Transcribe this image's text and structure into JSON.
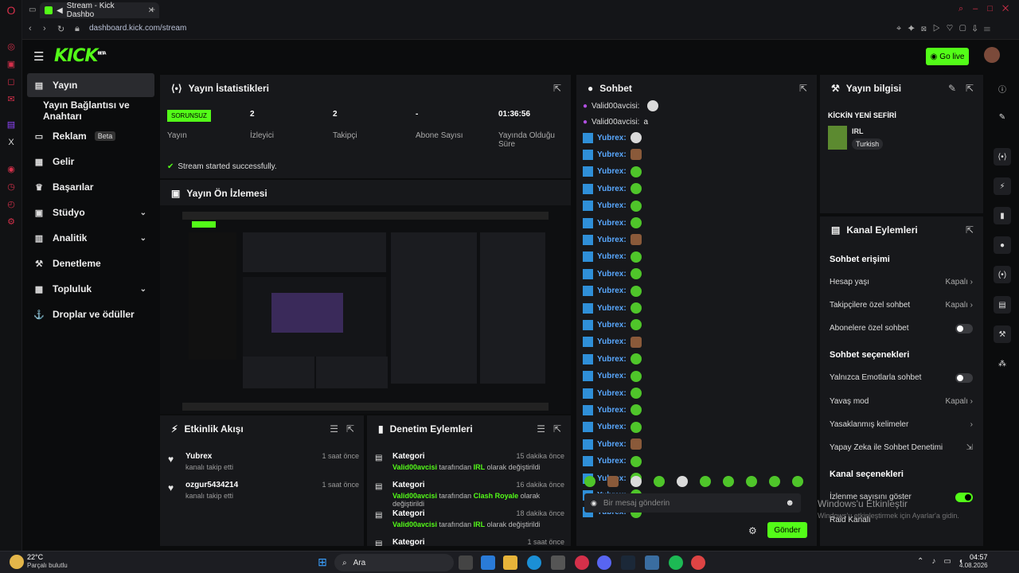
{
  "browser": {
    "tab_title": "Stream - Kick Dashbo",
    "url": "dashboard.kick.com/stream"
  },
  "header": {
    "logo": "KICK",
    "logo_badge": "BETA",
    "go_live": "Go live"
  },
  "sidebar": {
    "items": [
      {
        "label": "Yayın",
        "icon": "broadcast-icon"
      },
      {
        "label": "Yayın Bağlantısı ve Anahtarı",
        "icon": ""
      },
      {
        "label": "Reklam",
        "icon": "ad-icon",
        "badge": "Beta"
      },
      {
        "label": "Gelir",
        "icon": "revenue-icon"
      },
      {
        "label": "Başarılar",
        "icon": "trophy-icon"
      },
      {
        "label": "Stüdyo",
        "icon": "studio-icon"
      },
      {
        "label": "Analitik",
        "icon": "chart-icon"
      },
      {
        "label": "Denetleme",
        "icon": "wrench-icon"
      },
      {
        "label": "Topluluk",
        "icon": "community-icon"
      },
      {
        "label": "Droplar ve ödüller",
        "icon": "drops-icon"
      }
    ]
  },
  "stats": {
    "title": "Yayın İstatistikleri",
    "status_badge": "SORUNSUZ",
    "status_label": "Yayın",
    "items": [
      {
        "value": "2",
        "label": "İzleyici"
      },
      {
        "value": "2",
        "label": "Takipçi"
      },
      {
        "value": "-",
        "label": "Abone Sayısı"
      },
      {
        "value": "01:36:56",
        "label": "Yayında Olduğu Süre"
      }
    ],
    "success": "Stream started successfully."
  },
  "preview": {
    "title": "Yayın Ön İzlemesi"
  },
  "activity": {
    "title": "Etkinlik Akışı",
    "items": [
      {
        "name": "Yubrex",
        "sub": "kanalı takip etti",
        "time": "1 saat önce"
      },
      {
        "name": "ozgur5434214",
        "sub": "kanalı takip etti",
        "time": "1 saat önce"
      }
    ]
  },
  "moderation": {
    "title": "Denetim Eylemleri",
    "items": [
      {
        "name": "Kategori",
        "user": "Valid00avcisi",
        "mid": " tarafından ",
        "cat": "IRL",
        "end": " olarak değiştirildi",
        "time": "15 dakika önce"
      },
      {
        "name": "Kategori",
        "user": "Valid00avcisi",
        "mid": " tarafından ",
        "cat": "Clash Royale",
        "end": " olarak değiştirildi",
        "time": "16 dakika önce"
      },
      {
        "name": "Kategori",
        "user": "Valid00avcisi",
        "mid": " tarafından ",
        "cat": "IRL",
        "end": " olarak değiştirildi",
        "time": "18 dakika önce"
      },
      {
        "name": "Kategori",
        "user": "",
        "mid": "",
        "cat": "",
        "end": "",
        "time": "1 saat önce"
      }
    ]
  },
  "chat": {
    "title": "Sohbet",
    "placeholder": "Bir mesaj gönderin",
    "send": "Gönder",
    "top_lines": [
      {
        "name": "Valid00avcisi:",
        "text": ""
      },
      {
        "name": "Valid00avcisi:",
        "text": "a"
      }
    ],
    "user": "Yubrex:",
    "emote_pattern": [
      "w",
      "b",
      "g",
      "g",
      "g",
      "g",
      "b",
      "g",
      "g",
      "g",
      "g",
      "g",
      "b",
      "g",
      "g",
      "g",
      "g",
      "g",
      "b",
      "g",
      "g",
      "g",
      "g"
    ]
  },
  "stream_info": {
    "title": "Yayın bilgisi",
    "stream_title": "KİCKİN YENİ SEFİRİ",
    "category": "IRL",
    "language": "Turkish"
  },
  "channel_actions": {
    "title": "Kanal Eylemleri",
    "sec1": "Sohbet erişimi",
    "sec2": "Sohbet seçenekleri",
    "sec3": "Kanal seçenekleri",
    "o1": "Hesap yaşı",
    "o1v": "Kapalı",
    "o2": "Takipçilere özel sohbet",
    "o2v": "Kapalı",
    "o3": "Abonelere özel sohbet",
    "o4": "Yalnızca Emotlarla sohbet",
    "o5": "Yavaş mod",
    "o5v": "Kapalı",
    "o6": "Yasaklanmış kelimeler",
    "o7": "Yapay Zeka ile Sohbet Denetimi",
    "o8": "İzlenme sayısını göster",
    "o9": "Raid Kanalı"
  },
  "taskbar": {
    "temp": "22°C",
    "weather": "Parçalı bulutlu",
    "search": "Ara",
    "time": "04:57",
    "date": "4.08.2026"
  },
  "watermark": {
    "line1": "Windows'u Etkinleştir",
    "line2": "Windows'u etkinleştirmek için Ayarlar'a gidin."
  },
  "colors": {
    "accent": "#53fc18",
    "chat_name": "#59a8ff",
    "opera": "#d4304a"
  }
}
